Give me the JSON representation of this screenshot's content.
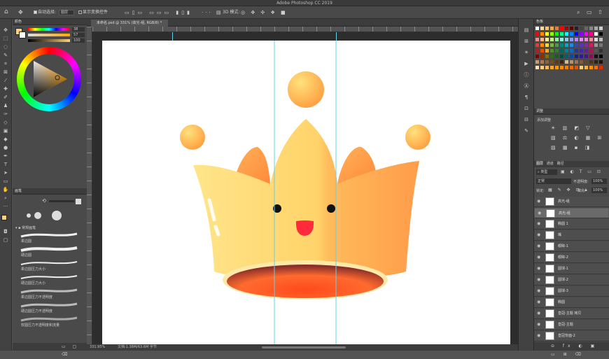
{
  "app": {
    "title": "Adobe Photoshop CC 2019"
  },
  "options": {
    "auto_select_label": "自动选择:",
    "auto_select_value": "图层",
    "show_transform_label": "显示变换控件",
    "mode_3d": "3D 模式:"
  },
  "document": {
    "tab_label": "未命名.psd @ 331% (高光-组, RGB/8) *"
  },
  "status": {
    "zoom": "331.95%",
    "doc_size": "文档:1.38M/63.6M 字节"
  },
  "color_panel": {
    "tab": "颜色",
    "sliders": [
      {
        "label": "H",
        "value": "38"
      },
      {
        "label": "S",
        "value": "57"
      },
      {
        "label": "B",
        "value": "100"
      }
    ],
    "fg_color": "#ffd27a",
    "bg_color": "#ffffff"
  },
  "brush_panel": {
    "tab": "画笔",
    "group_name": "常规画笔",
    "brushes": [
      "柔边圆",
      "硬边圆",
      "柔边圆压力大小",
      "硬边圆压力大小",
      "柔边圆压力不透明度",
      "硬边圆压力不透明度",
      "软圆压力不透明度和流量"
    ]
  },
  "swatches_panel": {
    "tab": "色板"
  },
  "adjust_panel": {
    "tab": "调整",
    "add_label": "添加调整"
  },
  "layers_panel": {
    "tabs": [
      "图层",
      "通道",
      "路径"
    ],
    "kind_filter": "类型",
    "blend_mode": "正常",
    "opacity_label": "不透明度:",
    "opacity_value": "100%",
    "lock_label": "锁定:",
    "fill_label": "填充:",
    "fill_value": "100%",
    "layers": [
      "高光-组",
      "高光-组",
      "椭圆 1",
      "嘴",
      "眼睛-1",
      "眼睛-2",
      "圆球-1",
      "圆球-2",
      "圆球-3",
      "椭圆",
      "皇冠-主题 拷贝",
      "皇冠-主题",
      "皇冠背面-2"
    ],
    "selected_index": 1
  },
  "colors": {
    "crown_light": "#ffe27d",
    "crown_orange": "#ffaa4f",
    "mouth": "#ff2b3a",
    "guide": "#5fd3e8"
  }
}
